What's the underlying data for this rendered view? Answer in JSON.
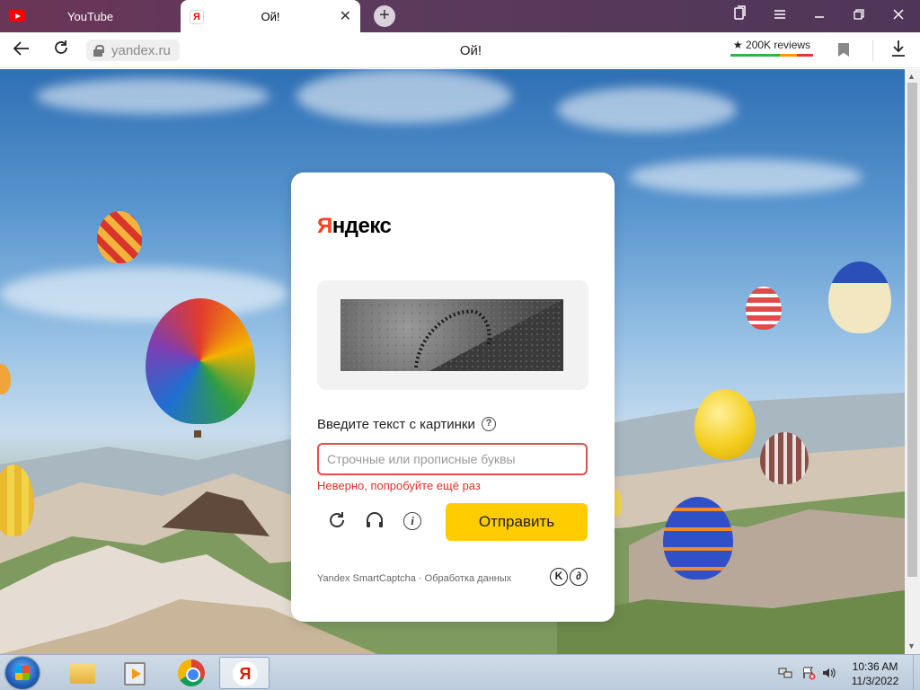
{
  "browser": {
    "tabs": [
      {
        "title": "YouTube",
        "favicon": "youtube-icon"
      },
      {
        "title": "Ой!",
        "favicon": "yandex-favicon-icon",
        "favicon_text": "Я"
      }
    ],
    "new_tab_glyph": "+",
    "close_glyph": "✕",
    "address": "yandex.ru",
    "page_title": "Ой!",
    "reviews": "★ 200K reviews",
    "reviews_bar_colors": [
      "#3cb043",
      "#3cb043",
      "#3cb043",
      "#ff9800",
      "#e53935"
    ]
  },
  "captcha": {
    "logo_first": "Я",
    "logo_rest": "ндекс",
    "prompt": "Введите текст с картинки",
    "help_glyph": "?",
    "input_placeholder": "Строчные или прописные буквы",
    "input_value": "",
    "error": "Неверно, попробуйте ещё раз",
    "refresh_glyph": "↻",
    "audio_glyph": "🎧",
    "info_glyph": "i",
    "submit": "Отправить",
    "footer_left": "Yandex SmartCaptcha",
    "footer_sep": " · ",
    "footer_right": "Обработка данных",
    "footer_icon_1": "K",
    "footer_icon_2": "∂"
  },
  "colors": {
    "brand_red": "#fc3f1d",
    "submit_yellow": "#ffcc00",
    "error_red": "#e0302a"
  },
  "taskbar": {
    "time": "10:36 AM",
    "date": "11/3/2022",
    "volume_glyph": "🔊"
  }
}
